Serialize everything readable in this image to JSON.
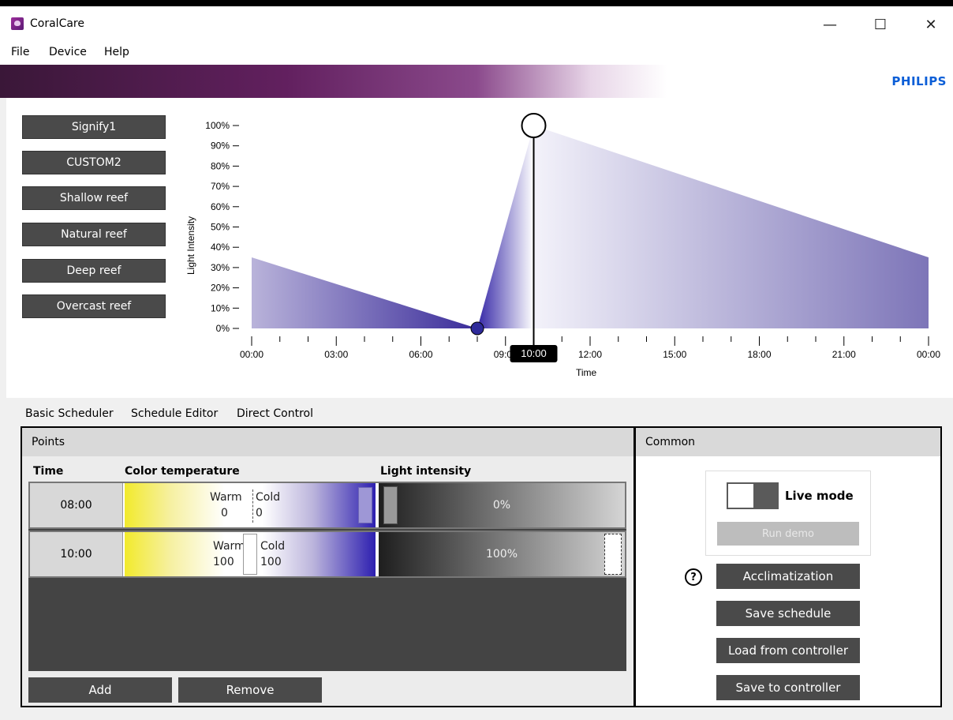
{
  "window": {
    "title": "CoralCare",
    "minimize": "—",
    "maximize": "☐",
    "close": "✕"
  },
  "menu": [
    "File",
    "Device",
    "Help"
  ],
  "brand": "PHILIPS",
  "presets": [
    "Signify1",
    "CUSTOM2",
    "Shallow reef",
    "Natural reef",
    "Deep reef",
    "Overcast reef"
  ],
  "chart_data": {
    "type": "area",
    "xlabel": "Time",
    "ylabel": "Light Intensity",
    "x_ticks": [
      "00:00",
      "03:00",
      "06:00",
      "09:00",
      "12:00",
      "15:00",
      "18:00",
      "21:00",
      "00:00"
    ],
    "y_ticks": [
      "0%",
      "10%",
      "20%",
      "30%",
      "40%",
      "50%",
      "60%",
      "70%",
      "80%",
      "90%",
      "100%"
    ],
    "ylim": [
      0,
      100
    ],
    "points": [
      {
        "time": "08:00",
        "value": 0
      },
      {
        "time": "10:00",
        "value": 100
      }
    ],
    "start_value": 35,
    "end_value": 35,
    "selected_time_label": "10:00",
    "grid": false
  },
  "tabs": [
    "Basic Scheduler",
    "Schedule Editor",
    "Direct Control"
  ],
  "points_panel": {
    "title": "Points",
    "headers": {
      "time": "Time",
      "color": "Color temperature",
      "intensity": "Light intensity"
    },
    "rows": [
      {
        "time": "08:00",
        "warm_label": "Warm",
        "warm": "0",
        "cold_label": "Cold",
        "cold": "0",
        "intensity": "0%"
      },
      {
        "time": "10:00",
        "warm_label": "Warm",
        "warm": "100",
        "cold_label": "Cold",
        "cold": "100",
        "intensity": "100%"
      }
    ],
    "add": "Add",
    "remove": "Remove"
  },
  "common_panel": {
    "title": "Common",
    "live_mode": "Live mode",
    "run_demo": "Run demo",
    "help": "?",
    "acclimatization": "Acclimatization",
    "save_schedule": "Save schedule",
    "load_from_controller": "Load from controller",
    "save_to_controller": "Save to controller"
  }
}
